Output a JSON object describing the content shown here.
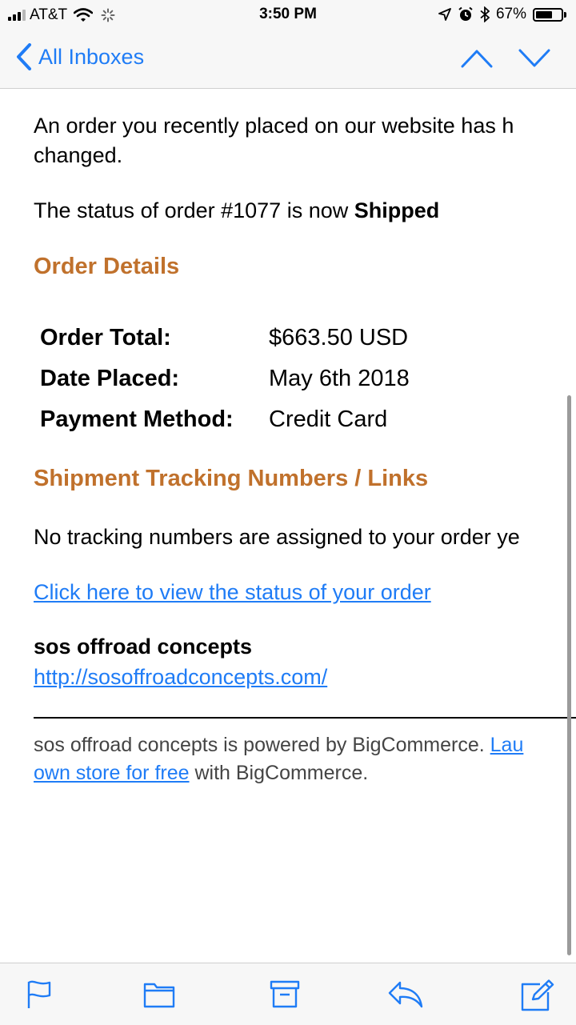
{
  "status_bar": {
    "carrier": "AT&T",
    "time": "3:50 PM",
    "battery": "67%",
    "battery_level": 0.67
  },
  "nav": {
    "back_label": "All Inboxes"
  },
  "email": {
    "intro_line1": "An order you recently placed on our website has h",
    "intro_line2": "changed.",
    "status_prefix": "The status of order #1077 is now ",
    "status_value": "Shipped",
    "order_details_heading": "Order Details",
    "details": [
      {
        "label": "Order Total:",
        "value": "$663.50 USD"
      },
      {
        "label": "Date Placed:",
        "value": "May 6th 2018"
      },
      {
        "label": "Payment Method:",
        "value": "Credit Card"
      }
    ],
    "tracking_heading": "Shipment Tracking Numbers / Links",
    "tracking_text": "No tracking numbers are assigned to your order ye",
    "status_link": "Click here to view the status of your order",
    "store_name": "sos offroad concepts",
    "store_url": "http://sosoffroadconcepts.com/",
    "footer_text1": "sos offroad concepts is powered by BigCommerce. ",
    "footer_link1": "Lau",
    "footer_link2": "own store for free",
    "footer_text2": " with BigCommerce."
  },
  "toolbar": {
    "icons": [
      "flag-icon",
      "folder-icon",
      "archive-icon",
      "reply-icon",
      "compose-icon"
    ]
  },
  "colors": {
    "accent": "#1f7cf6",
    "heading": "#c0712c"
  }
}
